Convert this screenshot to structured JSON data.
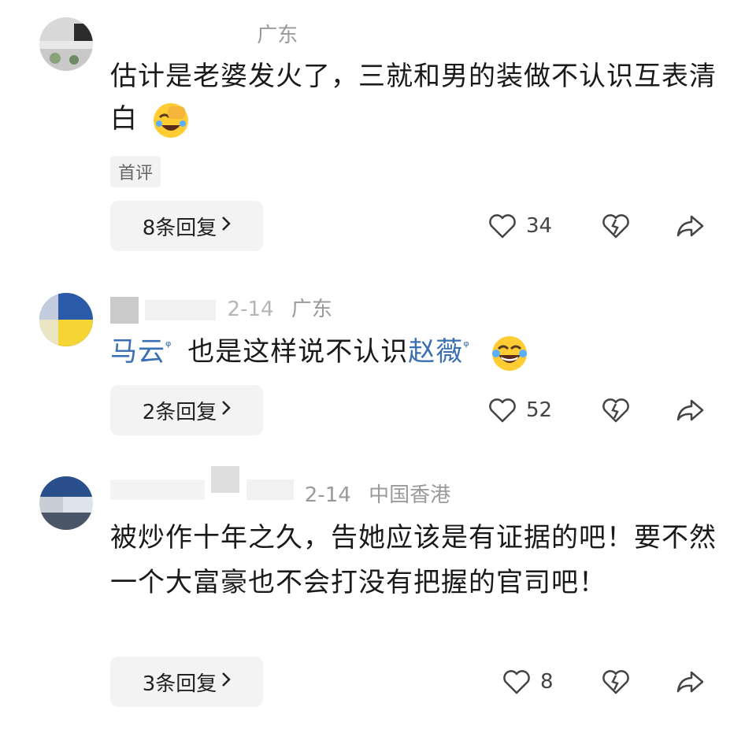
{
  "comments": [
    {
      "meta": {
        "name": "",
        "date": "",
        "location": "广东"
      },
      "text": "估计是老婆发火了，三就和男的装做不认识互表清白",
      "badge": "首评",
      "reply_label": "8条回复",
      "likes": "34"
    },
    {
      "meta": {
        "name": "",
        "date": "2-14",
        "location": "广东"
      },
      "text_parts": {
        "mention1": "马云",
        "middle": "也是这样说不认识",
        "mention2": "赵薇"
      },
      "reply_label": "2条回复",
      "likes": "52"
    },
    {
      "meta": {
        "name": "",
        "date": "2-14",
        "location": "中国香港"
      },
      "text": "被炒作十年之久，告她应该是有证据的吧！要不然一个大富豪也不会打没有把握的官司吧！",
      "reply_label": "3条回复",
      "likes": "8"
    }
  ],
  "icons": {
    "like": "heart-outline-icon",
    "dislike": "broken-heart-icon",
    "share": "share-arrow-icon",
    "mention_search": "search-icon",
    "emoji_facepalm": "laugh-cry-facepalm-emoji",
    "emoji_laugh": "laugh-tears-emoji"
  },
  "colors": {
    "mention": "#3a6fb4",
    "meta": "#9a9a9a",
    "button_bg": "#f3f3f3"
  }
}
